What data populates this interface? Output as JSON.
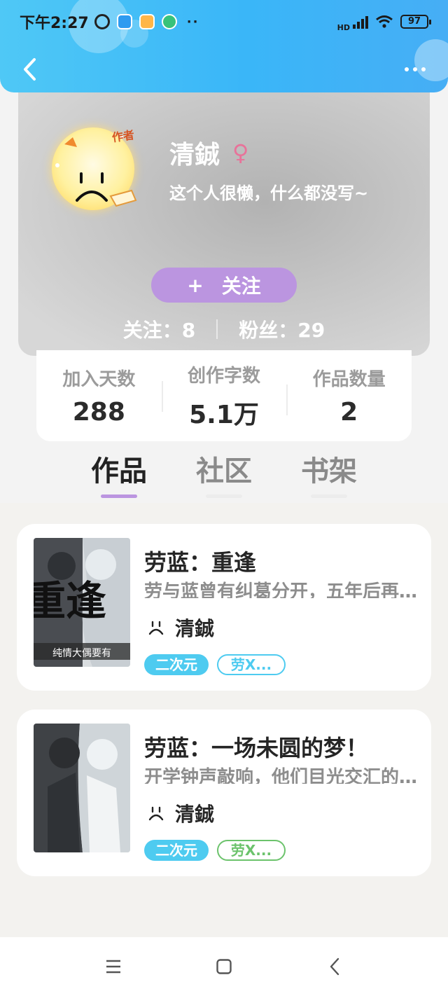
{
  "status_bar": {
    "time": "下午2:27",
    "dots": "··",
    "network": "HD",
    "battery": "97"
  },
  "header": {
    "back_icon": "chevron-left-icon",
    "more_icon": "more-horizontal-icon"
  },
  "profile": {
    "badge": "作者",
    "name": "清鋮",
    "gender_icon": "♀",
    "bio": "这个人很懒，什么都没写~",
    "follow_button": {
      "icon": "+",
      "label": "关注"
    },
    "following": "关注：8",
    "followers": "粉丝：29"
  },
  "counts": [
    {
      "label": "加入天数",
      "value": "288"
    },
    {
      "label": "创作字数",
      "value": "5.1万"
    },
    {
      "label": "作品数量",
      "value": "2"
    }
  ],
  "tabs": [
    {
      "label": "作品",
      "active": true
    },
    {
      "label": "社区",
      "active": false
    },
    {
      "label": "书架",
      "active": false
    }
  ],
  "works": [
    {
      "title": "劳蓝：重逢",
      "description": "劳与蓝曾有纠葛分开，五年后再次重逢…",
      "author": "清鋮",
      "tag_primary": "二次元",
      "tag_secondary": "劳X...",
      "tag_secondary_color": "#4ecbf0",
      "cover_text": "重逢",
      "cover_caption": "纯情大偶要有"
    },
    {
      "title": "劳蓝：一场未圆的梦！",
      "description": "开学钟声敲响，他们目光交汇的那一刻…",
      "author": "清鋮",
      "tag_primary": "二次元",
      "tag_secondary": "劳X...",
      "tag_secondary_color": "#6cc36c"
    }
  ],
  "system_nav": {
    "menu_icon": "menu-icon",
    "home_icon": "home-square-icon",
    "back_icon": "back-triangle-icon"
  }
}
